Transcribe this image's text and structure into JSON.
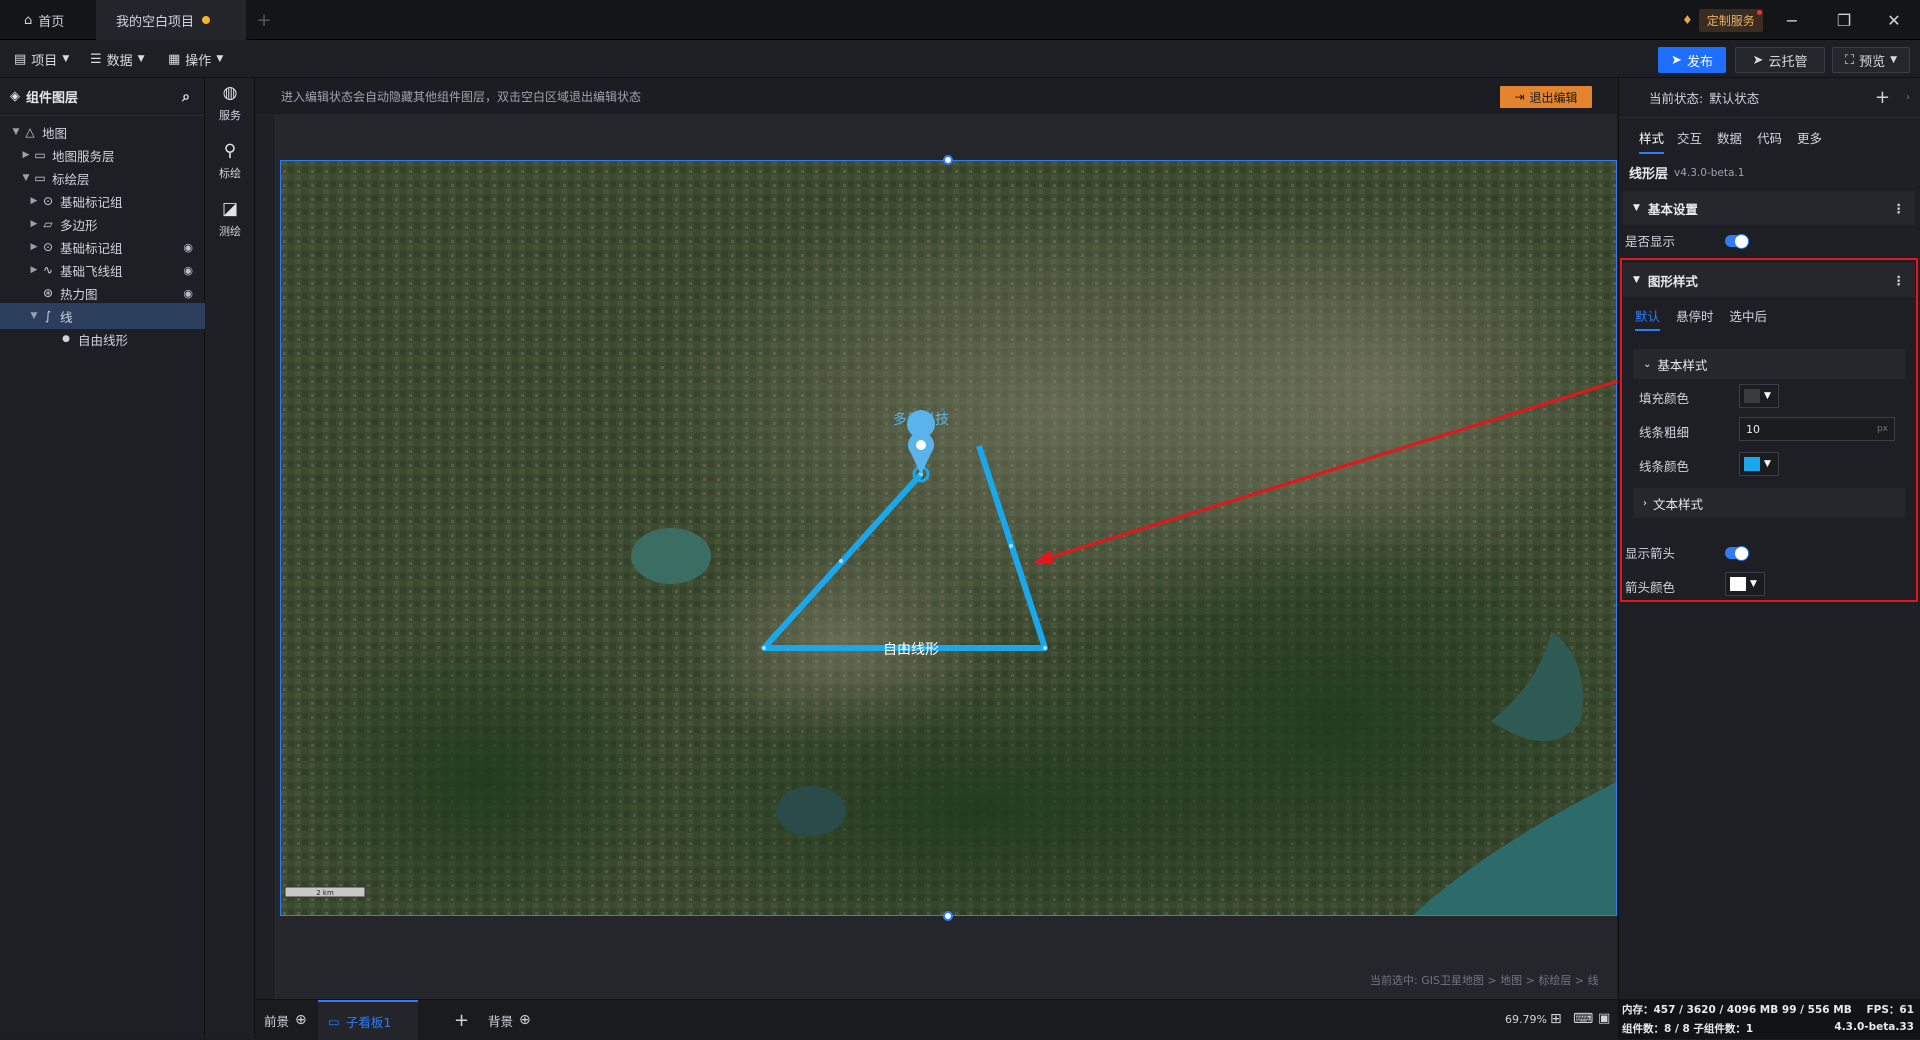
{
  "titlebar": {
    "home_tab": "首页",
    "project_tab": "我的空白项目",
    "custom_service": "定制服务"
  },
  "toolbar": {
    "project_menu": "项目",
    "data_menu": "数据",
    "operate_menu": "操作",
    "publish": "发布",
    "cloud_host": "云托管",
    "preview": "预览"
  },
  "layers": {
    "title": "组件图层",
    "items": [
      {
        "label": "地图",
        "icon": "map-icon"
      },
      {
        "label": "地图服务层",
        "icon": "folder-icon"
      },
      {
        "label": "标绘层",
        "icon": "folder-icon"
      },
      {
        "label": "基础标记组",
        "icon": "marker-icon"
      },
      {
        "label": "多边形",
        "icon": "polygon-icon"
      },
      {
        "label": "基础标记组",
        "icon": "marker-icon"
      },
      {
        "label": "基础飞线组",
        "icon": "flyline-icon"
      },
      {
        "label": "热力图",
        "icon": "heatmap-icon"
      },
      {
        "label": "线",
        "icon": "line-icon"
      },
      {
        "label": "自由线形",
        "icon": "bullet-icon"
      }
    ]
  },
  "rail": {
    "service": "服务",
    "plot": "标绘",
    "measure": "测绘"
  },
  "canvas": {
    "hint": "进入编辑状态会自动隐藏其他组件图层，双击空白区域退出编辑状态",
    "exit_edit": "退出编辑",
    "marker_label": "多看科技",
    "line_label": "自由线形",
    "scale_label": "2 km",
    "breadcrumb": "当前选中: GIS卫星地图 > 地图 > 标绘层 > 线"
  },
  "bottom": {
    "foreground": "前景",
    "subpanel": "子看板1",
    "background": "背景",
    "zoom": "69.79%"
  },
  "right": {
    "state_label": "当前状态:",
    "state_value": "默认状态",
    "tabs": [
      "样式",
      "交互",
      "数据",
      "代码",
      "更多"
    ],
    "component_name": "线形层",
    "version": "v4.3.0-beta.1",
    "basic_settings": "基本设置",
    "visible": "是否显示",
    "shape_style": "图形样式",
    "state_tabs": [
      "默认",
      "悬停时",
      "选中后"
    ],
    "basic_style": "基本样式",
    "fill_color": "填充颜色",
    "line_width": "线条粗细",
    "line_width_value": "10",
    "line_width_unit": "px",
    "line_color": "线条颜色",
    "text_style": "文本样式",
    "show_arrow": "显示箭头",
    "arrow_color": "箭头颜色"
  },
  "colors": {
    "accent": "#2f7cf6",
    "line": "#1aa7ec",
    "highlight": "#e3161c",
    "exit_button": "#e3852e"
  },
  "status": {
    "memory": "内存：457 / 3620 / 4096 MB  99 / 556 MB",
    "fps": "FPS：61",
    "components": "组件数：8 / 8   子组件数：1",
    "version": "4.3.0-beta.33"
  }
}
